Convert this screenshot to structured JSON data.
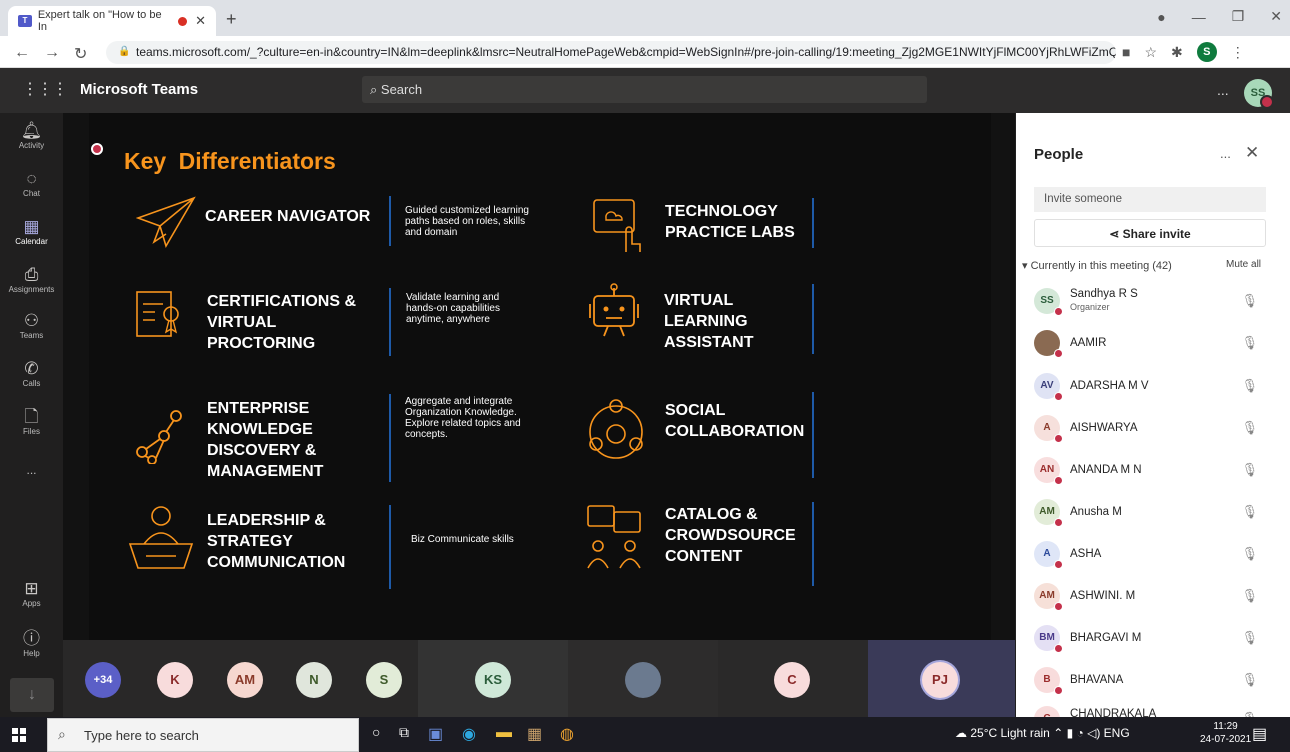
{
  "browser": {
    "tab_title": "Expert talk on \"How to be In",
    "new_tab": "+",
    "url": "teams.microsoft.com/_?culture=en-in&country=IN&lm=deeplink&lmsrc=NeutralHomePageWeb&cmpid=WebSignIn#/pre-join-calling/19:meeting_Zjg2MGE1NWItYjFlMC00YjRhLWFiZmQtMjAyO...",
    "profile_initial": "S"
  },
  "teams": {
    "app_name": "Microsoft Teams",
    "search_placeholder": "Search",
    "header_more": "...",
    "user_initials": "SS"
  },
  "rail": {
    "items": [
      {
        "label": "Activity",
        "icon": "bell-icon"
      },
      {
        "label": "Chat",
        "icon": "chat-icon"
      },
      {
        "label": "Calendar",
        "icon": "calendar-icon"
      },
      {
        "label": "Assignments",
        "icon": "assignments-icon"
      },
      {
        "label": "Teams",
        "icon": "teams-icon"
      },
      {
        "label": "Calls",
        "icon": "phone-icon"
      },
      {
        "label": "Files",
        "icon": "file-icon"
      },
      {
        "label": "...",
        "icon": "more-icon"
      },
      {
        "label": "Apps",
        "icon": "apps-icon"
      },
      {
        "label": "Help",
        "icon": "help-icon"
      }
    ]
  },
  "slide": {
    "title": "Key Differentiators",
    "items": [
      {
        "title": "CAREER NAVIGATOR",
        "desc": "Guided customized learning paths based on roles, skills and domain"
      },
      {
        "title": "TECHNOLOGY PRACTICE LABS",
        "desc": ""
      },
      {
        "title": "CERTIFICATIONS & VIRTUAL PROCTORING",
        "desc": "Validate learning and hands-on capabilities anytime, anywhere"
      },
      {
        "title": "VIRTUAL LEARNING ASSISTANT",
        "desc": ""
      },
      {
        "title": "ENTERPRISE KNOWLEDGE DISCOVERY & MANAGEMENT",
        "desc": "Aggregate and integrate Organization Knowledge. Explore related topics and concepts."
      },
      {
        "title": "SOCIAL COLLABORATION",
        "desc": ""
      },
      {
        "title": "LEADERSHIP & STRATEGY COMMUNICATION",
        "desc": "Biz Communicate skills"
      },
      {
        "title": "CATALOG & CROWDSOURCE CONTENT",
        "desc": ""
      }
    ],
    "accent_color": "#f7941d"
  },
  "strip": {
    "overflow": "+34",
    "avatars": [
      "K",
      "AM",
      "N",
      "S",
      "KS",
      "C",
      "PJ"
    ]
  },
  "people": {
    "title": "People",
    "more": "...",
    "invite_placeholder": "Invite someone",
    "share_label": "Share invite",
    "section_label": "Currently in this meeting (42)",
    "mute_all": "Mute all",
    "participants": [
      {
        "initials": "SS",
        "name": "Sandhya R S",
        "role": "Organizer",
        "color": "#d4e8d8",
        "fg": "#2b5d3b"
      },
      {
        "initials": "",
        "name": "AAMIR",
        "role": "",
        "color": "#8a6a52",
        "fg": "#fff"
      },
      {
        "initials": "AV",
        "name": "ADARSHA M V",
        "role": "",
        "color": "#dfe3f4",
        "fg": "#3b3f7a"
      },
      {
        "initials": "A",
        "name": "AISHWARYA",
        "role": "",
        "color": "#f6e0dc",
        "fg": "#8a3a2a"
      },
      {
        "initials": "AN",
        "name": "ANANDA M N",
        "role": "",
        "color": "#f8dede",
        "fg": "#9b2c2c"
      },
      {
        "initials": "AM",
        "name": "Anusha M",
        "role": "",
        "color": "#e2ecd8",
        "fg": "#3e5a2a"
      },
      {
        "initials": "A",
        "name": "ASHA",
        "role": "",
        "color": "#dfe6f7",
        "fg": "#2c4a9b"
      },
      {
        "initials": "AM",
        "name": "ASHWINI. M",
        "role": "",
        "color": "#f6e0d8",
        "fg": "#8a3a2a"
      },
      {
        "initials": "BM",
        "name": "BHARGAVI M",
        "role": "",
        "color": "#e4e0f4",
        "fg": "#4a3a8a"
      },
      {
        "initials": "B",
        "name": "BHAVANA",
        "role": "",
        "color": "#f8dcdc",
        "fg": "#9b2c2c"
      },
      {
        "initials": "C",
        "name": "CHANDRAKALA",
        "role": "",
        "color": "#f8dcdc",
        "fg": "#9b2c2c"
      }
    ]
  },
  "taskbar": {
    "search_placeholder": "Type here to search",
    "weather": "25°C  Light rain",
    "lang": "ENG",
    "time": "11:29",
    "date": "24-07-2021"
  }
}
